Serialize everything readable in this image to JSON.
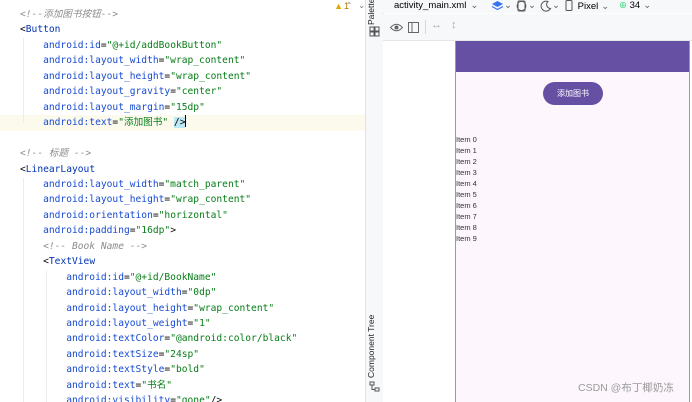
{
  "editor": {
    "warning_count": "1",
    "lines": [
      {
        "parts": [
          {
            "t": "<!--添加图书按钮-->",
            "c": "c-comment"
          }
        ]
      },
      {
        "parts": [
          {
            "t": "<",
            "c": "c-punct"
          },
          {
            "t": "Button",
            "c": "c-tag"
          }
        ]
      },
      {
        "parts": [
          {
            "t": "    android:id",
            "c": "c-attr"
          },
          {
            "t": "=",
            "c": "c-punct"
          },
          {
            "t": "\"@+id/addBookButton\"",
            "c": "c-val"
          }
        ]
      },
      {
        "parts": [
          {
            "t": "    android:layout_width",
            "c": "c-attr"
          },
          {
            "t": "=",
            "c": "c-punct"
          },
          {
            "t": "\"wrap_content\"",
            "c": "c-val"
          }
        ]
      },
      {
        "parts": [
          {
            "t": "    android:layout_height",
            "c": "c-attr"
          },
          {
            "t": "=",
            "c": "c-punct"
          },
          {
            "t": "\"wrap_content\"",
            "c": "c-val"
          }
        ]
      },
      {
        "parts": [
          {
            "t": "    android:layout_gravity",
            "c": "c-attr"
          },
          {
            "t": "=",
            "c": "c-punct"
          },
          {
            "t": "\"center\"",
            "c": "c-val"
          }
        ]
      },
      {
        "parts": [
          {
            "t": "    android:layout_margin",
            "c": "c-attr"
          },
          {
            "t": "=",
            "c": "c-punct"
          },
          {
            "t": "\"15dp\"",
            "c": "c-val"
          }
        ]
      },
      {
        "parts": [
          {
            "t": "    android:text",
            "c": "c-attr"
          },
          {
            "t": "=",
            "c": "c-punct"
          },
          {
            "t": "\"添加图书\"",
            "c": "c-val"
          },
          {
            "t": " ",
            "c": "c-punct"
          },
          {
            "t": "/>",
            "c": "c-close"
          }
        ],
        "current": true
      },
      {
        "parts": []
      },
      {
        "parts": [
          {
            "t": "<!-- 标题 -->",
            "c": "c-comment"
          }
        ]
      },
      {
        "parts": [
          {
            "t": "<",
            "c": "c-punct"
          },
          {
            "t": "LinearLayout",
            "c": "c-tag"
          }
        ]
      },
      {
        "parts": [
          {
            "t": "    android:layout_width",
            "c": "c-attr"
          },
          {
            "t": "=",
            "c": "c-punct"
          },
          {
            "t": "\"match_parent\"",
            "c": "c-val"
          }
        ]
      },
      {
        "parts": [
          {
            "t": "    android:layout_height",
            "c": "c-attr"
          },
          {
            "t": "=",
            "c": "c-punct"
          },
          {
            "t": "\"wrap_content\"",
            "c": "c-val"
          }
        ]
      },
      {
        "parts": [
          {
            "t": "    android:orientation",
            "c": "c-attr"
          },
          {
            "t": "=",
            "c": "c-punct"
          },
          {
            "t": "\"horizontal\"",
            "c": "c-val"
          }
        ]
      },
      {
        "parts": [
          {
            "t": "    android:padding",
            "c": "c-attr"
          },
          {
            "t": "=",
            "c": "c-punct"
          },
          {
            "t": "\"16dp\"",
            "c": "c-val"
          },
          {
            "t": ">",
            "c": "c-punct"
          }
        ]
      },
      {
        "parts": [
          {
            "t": "    <!-- Book Name -->",
            "c": "c-comment"
          }
        ]
      },
      {
        "parts": [
          {
            "t": "    <",
            "c": "c-punct"
          },
          {
            "t": "TextView",
            "c": "c-tag"
          }
        ]
      },
      {
        "parts": [
          {
            "t": "        android:id",
            "c": "c-attr"
          },
          {
            "t": "=",
            "c": "c-punct"
          },
          {
            "t": "\"@+id/BookName\"",
            "c": "c-val"
          }
        ]
      },
      {
        "parts": [
          {
            "t": "        android:layout_width",
            "c": "c-attr"
          },
          {
            "t": "=",
            "c": "c-punct"
          },
          {
            "t": "\"0dp\"",
            "c": "c-val"
          }
        ]
      },
      {
        "parts": [
          {
            "t": "        android:layout_height",
            "c": "c-attr"
          },
          {
            "t": "=",
            "c": "c-punct"
          },
          {
            "t": "\"wrap_content\"",
            "c": "c-val"
          }
        ]
      },
      {
        "parts": [
          {
            "t": "        android:layout_weight",
            "c": "c-attr"
          },
          {
            "t": "=",
            "c": "c-punct"
          },
          {
            "t": "\"1\"",
            "c": "c-val"
          }
        ]
      },
      {
        "parts": [
          {
            "t": "        android:textColor",
            "c": "c-attr"
          },
          {
            "t": "=",
            "c": "c-punct"
          },
          {
            "t": "\"@android:color/black\"",
            "c": "c-val"
          }
        ]
      },
      {
        "parts": [
          {
            "t": "        android:textSize",
            "c": "c-attr"
          },
          {
            "t": "=",
            "c": "c-punct"
          },
          {
            "t": "\"24sp\"",
            "c": "c-val"
          }
        ]
      },
      {
        "parts": [
          {
            "t": "        android:textStyle",
            "c": "c-attr"
          },
          {
            "t": "=",
            "c": "c-punct"
          },
          {
            "t": "\"bold\"",
            "c": "c-val"
          }
        ]
      },
      {
        "parts": [
          {
            "t": "        android:text",
            "c": "c-attr"
          },
          {
            "t": "=",
            "c": "c-punct"
          },
          {
            "t": "\"书名\"",
            "c": "c-val"
          }
        ]
      },
      {
        "parts": [
          {
            "t": "        android:visibility",
            "c": "c-attr"
          },
          {
            "t": "=",
            "c": "c-punct"
          },
          {
            "t": "\"gone\"",
            "c": "c-val"
          },
          {
            "t": "/>",
            "c": "c-punct"
          }
        ]
      }
    ]
  },
  "side_strip": {
    "palette_label": "Palette",
    "component_tree_label": "Component Tree"
  },
  "design_toolbar": {
    "file_name": "activity_main.xml",
    "device": "Pixel",
    "api_level": "34"
  },
  "preview": {
    "button_label": "添加图书",
    "list_items": [
      "Item 0",
      "Item 1",
      "Item 2",
      "Item 3",
      "Item 4",
      "Item 5",
      "Item 6",
      "Item 7",
      "Item 8",
      "Item 9"
    ]
  },
  "watermark": "CSDN @布丁椰奶冻",
  "colors": {
    "app_primary": "#6650a4",
    "preview_background": "#fdf7fd",
    "xml_tag": "#0033b3",
    "xml_attribute": "#174ad4",
    "xml_value": "#067d17",
    "comment": "#8c8c8c"
  }
}
